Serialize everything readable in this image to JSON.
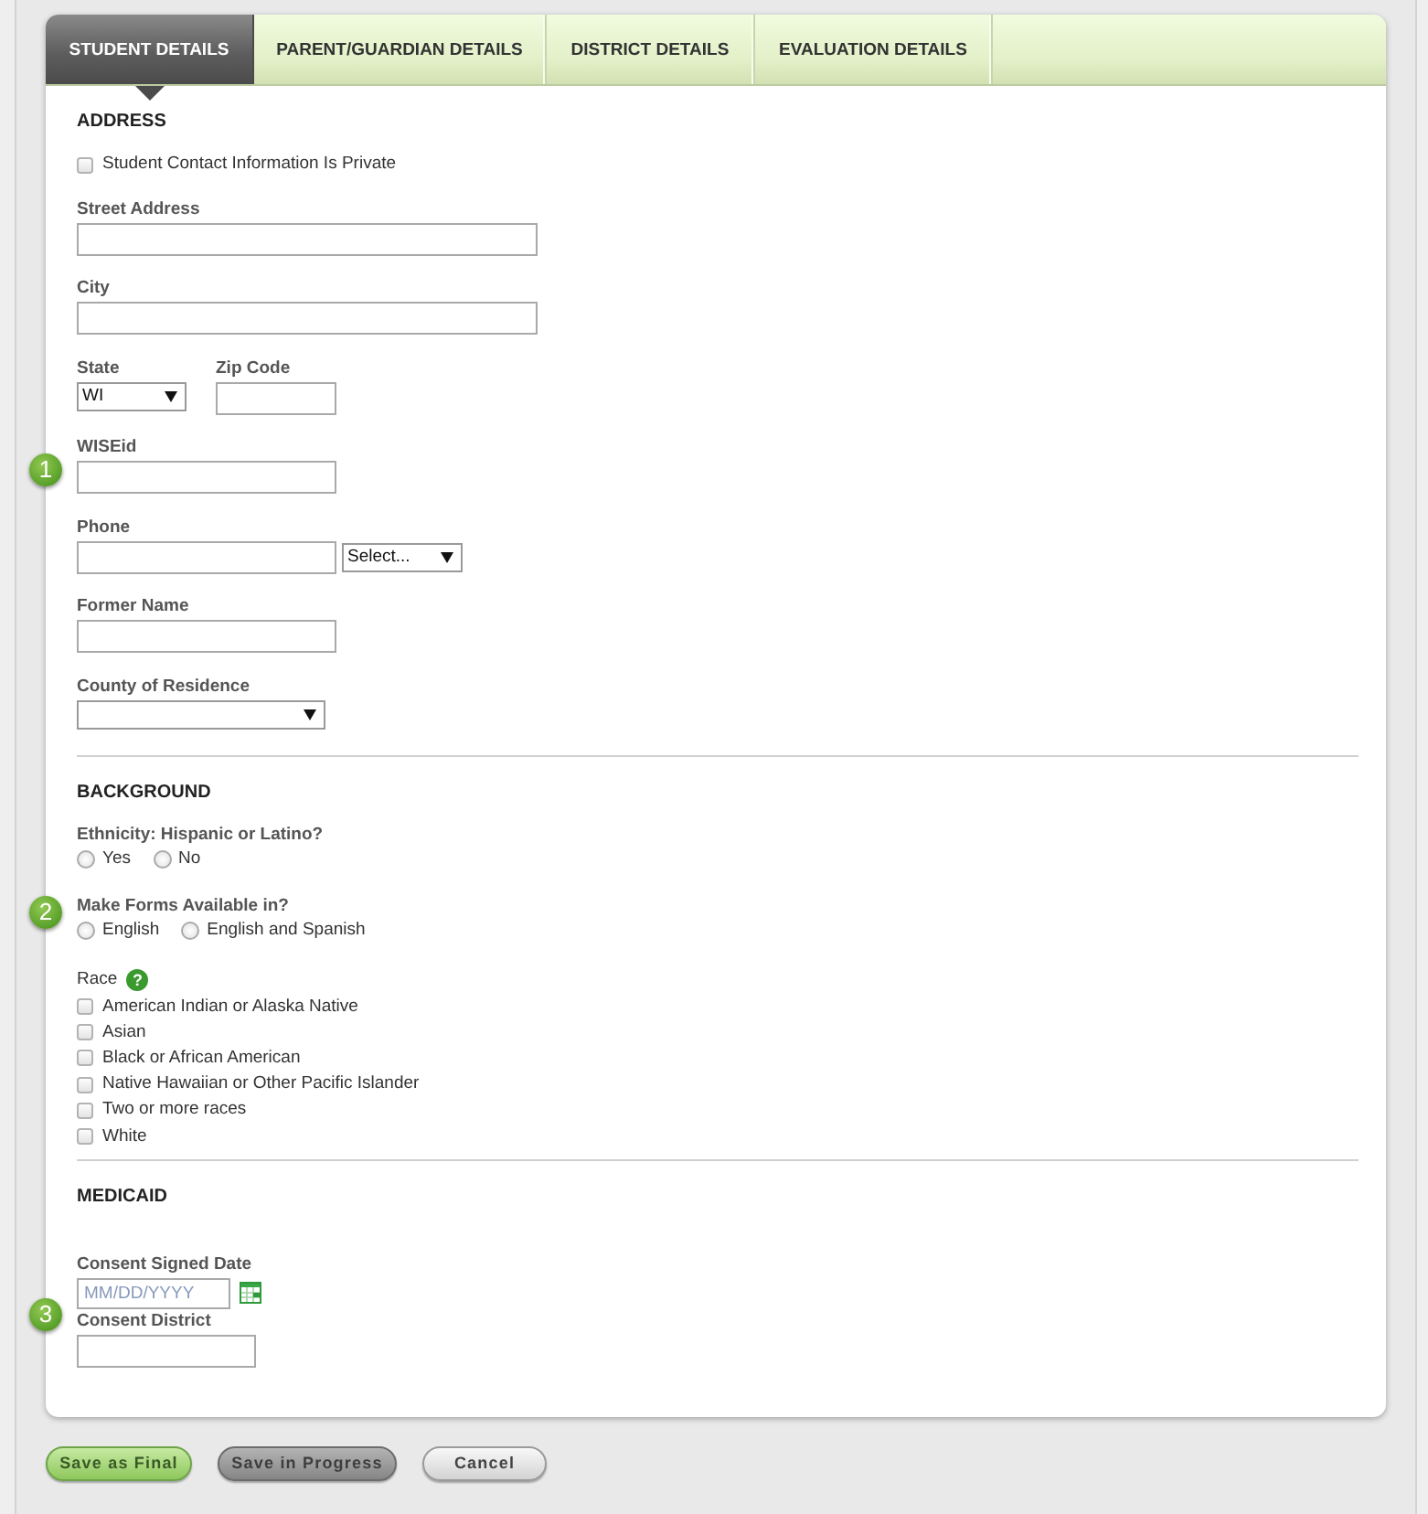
{
  "tabs": [
    {
      "label": "STUDENT DETAILS",
      "selected": true
    },
    {
      "label": "PARENT/GUARDIAN DETAILS",
      "selected": false
    },
    {
      "label": "DISTRICT DETAILS",
      "selected": false
    },
    {
      "label": "EVALUATION DETAILS",
      "selected": false
    }
  ],
  "sections": [
    {
      "heading": "ADDRESS",
      "rows": [
        {
          "fields": [
            {
              "kind": "checkbox",
              "label": "Student Contact Information Is Private",
              "checked": false
            }
          ]
        },
        {
          "fields": [
            {
              "kind": "text",
              "label": "Street Address"
            }
          ]
        },
        {
          "fields": [
            {
              "kind": "text",
              "label": "City"
            }
          ]
        },
        {
          "fields": [
            {
              "kind": "select",
              "label": "State",
              "value": "WI"
            },
            {
              "kind": "text",
              "label": "Zip Code"
            }
          ]
        },
        {
          "fields": [
            {
              "kind": "text",
              "label": "WISEid",
              "callout": "1"
            }
          ]
        },
        {
          "fields": [
            {
              "kind": "text",
              "label": "Phone"
            },
            {
              "kind": "select",
              "value": "Select..."
            }
          ]
        },
        {
          "fields": [
            {
              "kind": "text",
              "label": "Former Name"
            }
          ]
        },
        {
          "fields": [
            {
              "kind": "select",
              "label": "County of Residence"
            }
          ]
        }
      ]
    },
    {
      "heading": "BACKGROUND",
      "rows": [
        {
          "fields": [
            {
              "kind": "radio",
              "label": "Ethnicity: Hispanic or Latino?",
              "options": [
                {
                  "label": "Yes",
                  "selected": false
                },
                {
                  "label": "No",
                  "selected": false
                }
              ]
            }
          ]
        },
        {
          "fields": [
            {
              "kind": "radio",
              "label": "Make Forms Available in?",
              "callout": "2",
              "options": [
                {
                  "label": "English",
                  "selected": false
                },
                {
                  "label": "English and Spanish",
                  "selected": false
                }
              ]
            }
          ]
        },
        {
          "fields": [
            {
              "kind": "checklist",
              "label": "Race",
              "help": "?",
              "options": [
                {
                  "label": "American Indian or Alaska Native",
                  "checked": false
                },
                {
                  "label": "Asian",
                  "checked": false
                },
                {
                  "label": "Black or African American",
                  "checked": false
                },
                {
                  "label": "Native Hawaiian or Other Pacific Islander",
                  "checked": false
                },
                {
                  "label": "Two or more races",
                  "checked": false
                },
                {
                  "label": "White",
                  "checked": false
                }
              ]
            }
          ]
        }
      ]
    },
    {
      "heading": "MEDICAID",
      "rows": [
        {
          "fields": [
            {
              "kind": "date",
              "label": "Consent Signed Date",
              "placeholder": "MM/DD/YYYY"
            }
          ]
        },
        {
          "fields": [
            {
              "kind": "text",
              "label": "Consent District",
              "callout": "3"
            }
          ]
        }
      ]
    }
  ],
  "buttons": [
    {
      "label": "Save as Final",
      "kind": "primary"
    },
    {
      "label": "Save in Progress",
      "kind": "secondary"
    },
    {
      "label": "Cancel",
      "kind": "plain"
    }
  ]
}
